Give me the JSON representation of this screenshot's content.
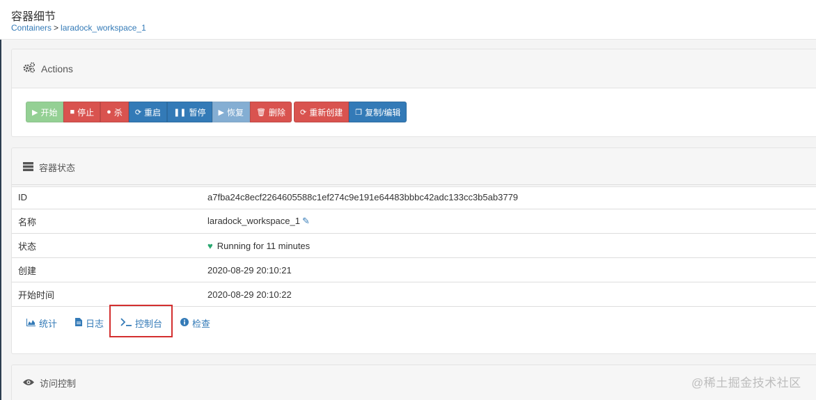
{
  "page": {
    "title": "容器细节",
    "breadcrumb": {
      "root": "Containers",
      "separator": ">",
      "current": "laradock_workspace_1"
    }
  },
  "actions_panel": {
    "title": "Actions",
    "icon": "cogs-icon",
    "buttons": {
      "start": "开始",
      "stop": "停止",
      "kill": "杀",
      "restart": "重启",
      "pause": "暂停",
      "resume": "恢复",
      "remove": "删除",
      "recreate": "重新创建",
      "duplicate": "复制/编辑"
    }
  },
  "status_panel": {
    "title": "容器状态",
    "icon": "server-icon",
    "rows": [
      {
        "key": "ID",
        "value": "a7fba24c8ecf2264605588c1ef274c9e191e64483bbbc42adc133cc3b5ab3779"
      },
      {
        "key": "名称",
        "value": "laradock_workspace_1"
      },
      {
        "key": "状态",
        "value": "Running for 11 minutes"
      },
      {
        "key": "创建",
        "value": "2020-08-29 20:10:21"
      },
      {
        "key": "开始时间",
        "value": "2020-08-29 20:10:22"
      }
    ],
    "tools": {
      "stats": "统计",
      "logs": "日志",
      "console": "控制台",
      "inspect": "检查"
    }
  },
  "access_panel": {
    "title": "访问控制",
    "icon": "eye-icon"
  },
  "watermark": "@稀土掘金技术社区",
  "colors": {
    "primary": "#337ab7",
    "danger": "#d9534f",
    "success": "#5cb85c",
    "running": "#28a76f",
    "highlight": "#d32f2f"
  }
}
